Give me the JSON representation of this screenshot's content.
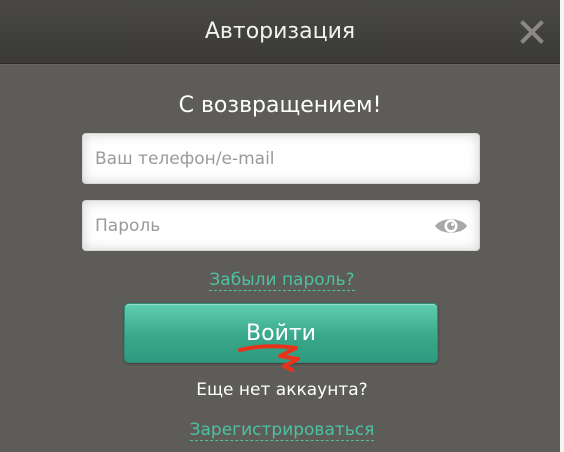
{
  "dialog": {
    "title": "Авторизация",
    "close_icon": "close-icon"
  },
  "form": {
    "welcome": "С возвращением!",
    "login_placeholder": "Ваш телефон/e-mail",
    "login_value": "",
    "password_placeholder": "Пароль",
    "password_value": "",
    "password_toggle_icon": "eye-icon",
    "forgot_link": "Забыли пароль?",
    "submit_label": "Войти",
    "no_account_text": "Еще нет аккаунта?",
    "register_link": "Зарегистрироваться"
  },
  "colors": {
    "accent": "#4dc1a1",
    "button": "#3aa88b",
    "background": "#5d5c58",
    "titlebar": "#3f3e3b",
    "annotation": "#e8331b"
  }
}
